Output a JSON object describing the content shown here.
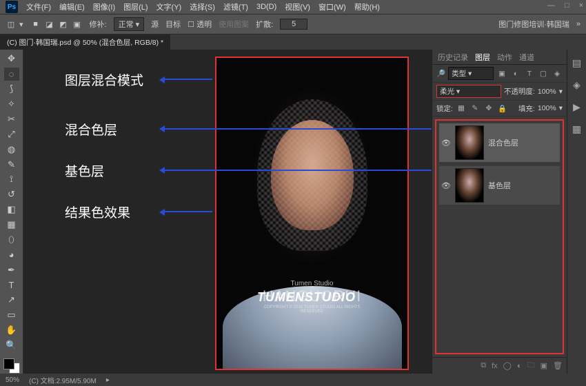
{
  "menu": {
    "items": [
      "文件(F)",
      "编辑(E)",
      "图像(I)",
      "图层(L)",
      "文字(Y)",
      "选择(S)",
      "滤镜(T)",
      "3D(D)",
      "视图(V)",
      "窗口(W)",
      "帮助(H)"
    ]
  },
  "winbtns": {
    "min": "—",
    "max": "□",
    "close": "×"
  },
  "optbar": {
    "repair": "修补:",
    "mode": "正常",
    "src": "源",
    "dest": "目标",
    "trans": "透明",
    "use_pattern": "使用图案",
    "diffuse": "扩散:",
    "diffuse_val": "5",
    "brand": "图门修图培训·韩国瑞"
  },
  "tab": {
    "title": "(C) 图门·韩国瑞.psd @ 50% (混合色层, RGB/8) *"
  },
  "annotations": {
    "a1": "图层混合模式",
    "a2": "混合色层",
    "a3": "基色层",
    "a4": "结果色效果"
  },
  "watermark": {
    "line1": "Tumen Studio",
    "line2": "HANGUORUI",
    "line3": "COPYRIGHT © 2016 TUMEN STUDIO ALL RIGHTS RESERVED"
  },
  "logo2": "TUMENSTUDIO",
  "panels": {
    "tabs": [
      "历史记录",
      "图层",
      "动作",
      "通道"
    ],
    "kind": "类型",
    "blend": "柔光",
    "opacity_lbl": "不透明度:",
    "opacity_val": "100%",
    "lock_lbl": "锁定:",
    "fill_lbl": "填充:",
    "fill_val": "100%",
    "layers": [
      {
        "name": "混合色层"
      },
      {
        "name": "基色层"
      }
    ]
  },
  "status": {
    "zoom": "50%",
    "doc": "(C) 文档:2.95M/5.90M"
  }
}
